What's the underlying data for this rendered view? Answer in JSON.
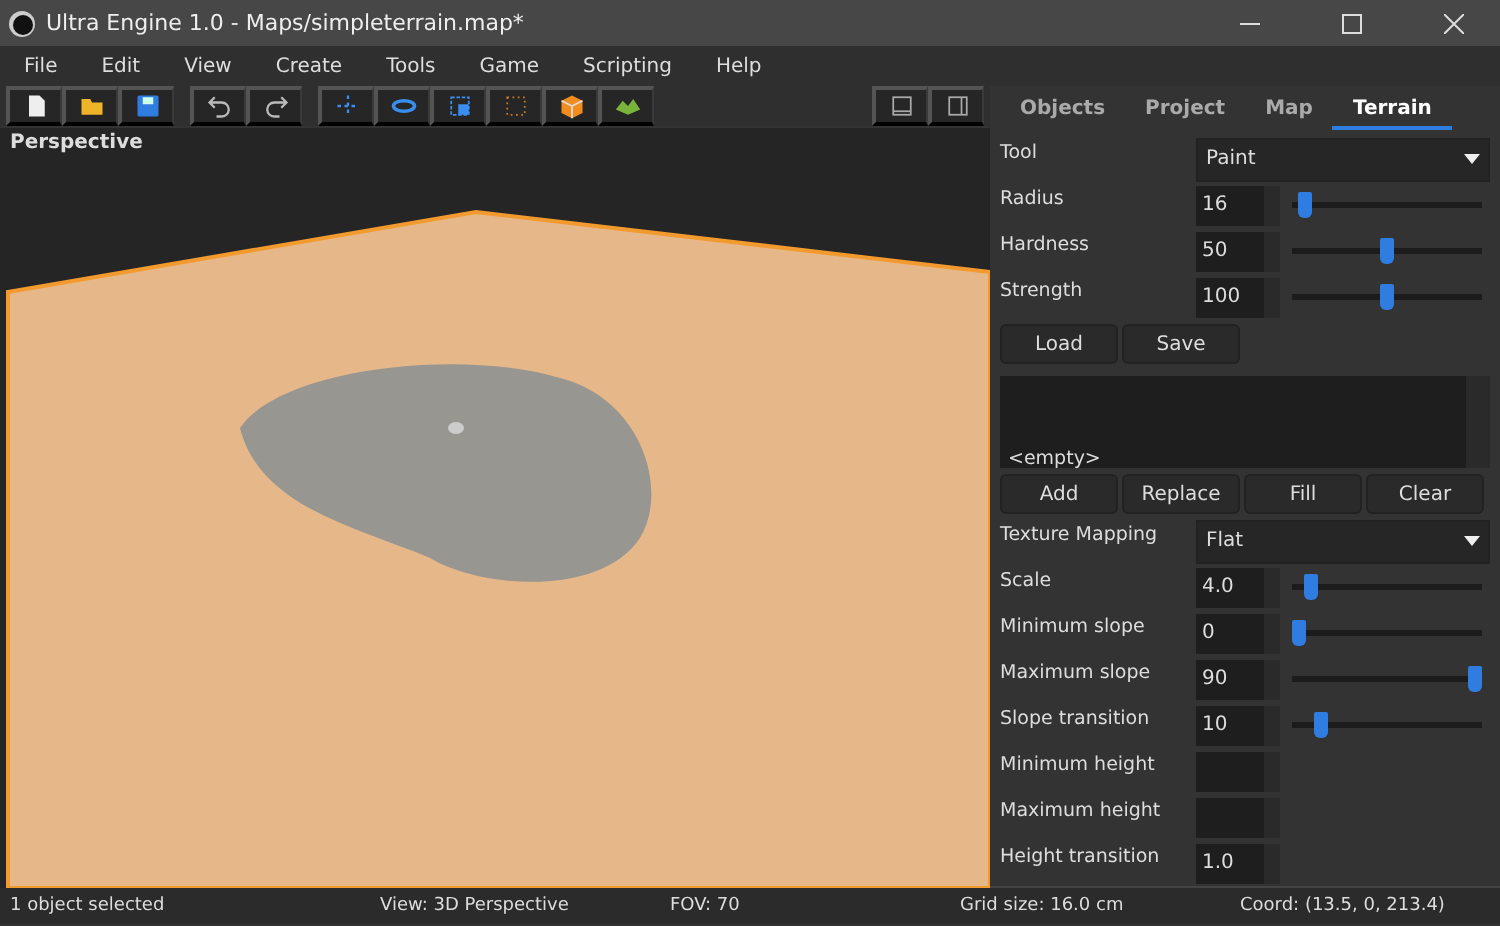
{
  "window": {
    "title": "Ultra Engine 1.0 - Maps/simpleterrain.map*"
  },
  "menu": [
    "File",
    "Edit",
    "View",
    "Create",
    "Tools",
    "Game",
    "Scripting",
    "Help"
  ],
  "viewport": {
    "title": "Perspective"
  },
  "tabs": [
    {
      "label": "Objects",
      "selected": false
    },
    {
      "label": "Project",
      "selected": false
    },
    {
      "label": "Map",
      "selected": false
    },
    {
      "label": "Terrain",
      "selected": true
    }
  ],
  "brush": [
    {
      "kind": "dropdown",
      "label": "Tool",
      "value": "Paint"
    },
    {
      "kind": "slider",
      "label": "Radius",
      "value": "16",
      "level": 0.03
    },
    {
      "kind": "slider",
      "label": "Hardness",
      "value": "50",
      "level": 0.5
    },
    {
      "kind": "slider",
      "label": "Strength",
      "value": "100",
      "level": 0.5
    }
  ],
  "file_buttons": [
    "Load",
    "Save"
  ],
  "layer_list": {
    "items": [
      "<empty>"
    ]
  },
  "layer_buttons": [
    "Add",
    "Replace",
    "Fill",
    "Clear"
  ],
  "layer_settings": [
    {
      "kind": "dropdown",
      "label": "Texture Mapping",
      "value": "Flat"
    },
    {
      "kind": "slider",
      "label": "Scale",
      "value": "4.0",
      "level": 0.07
    },
    {
      "kind": "slider",
      "label": "Minimum slope",
      "value": "0",
      "level": 0
    },
    {
      "kind": "slider",
      "label": "Maximum slope",
      "value": "90",
      "level": 1
    },
    {
      "kind": "slider",
      "label": "Slope transition",
      "value": "10",
      "level": 0.13
    },
    {
      "kind": "spin",
      "label": "Minimum height"
    },
    {
      "kind": "spin",
      "label": "Maximum height"
    },
    {
      "kind": "spin",
      "label": "Height transition",
      "value": "1.0"
    }
  ],
  "status_bar": [
    "1 object selected",
    "View: 3D Perspective",
    "FOV: 70",
    "Grid size: 16.0 cm",
    "Coord: (13.5, 0, 213.4)"
  ]
}
